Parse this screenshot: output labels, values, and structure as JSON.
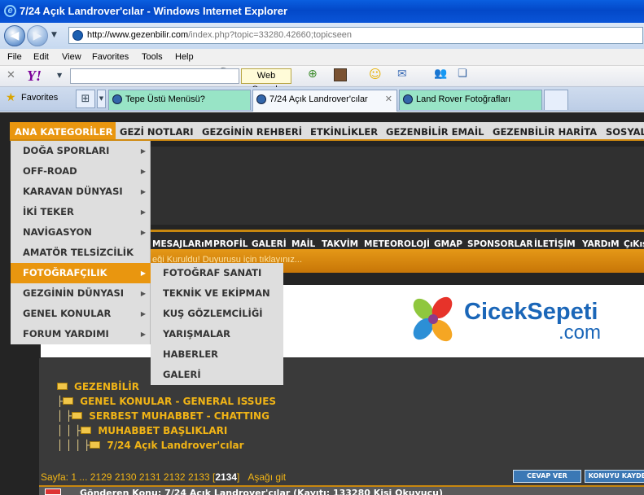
{
  "window": {
    "title": "7/24 Açık Landrover'cılar - Windows Internet Explorer"
  },
  "browser": {
    "back_label": "◀",
    "forward_label": "▶",
    "address_domain": "http://www.gezenbilir.com",
    "address_path": "/index.php?topic=33280.42660;topicseen",
    "menu": [
      "File",
      "Edit",
      "View",
      "Favorites",
      "Tools",
      "Help"
    ],
    "yahoo_logo": "Y!",
    "web_search_label": "Web Search",
    "favorites_label": "Favorites",
    "tabs": [
      {
        "label": "Tepe Üstü Menüsü?"
      },
      {
        "label": "7/24 Açık Landrover'cılar"
      },
      {
        "label": "Land Rover Fotoğrafları"
      }
    ]
  },
  "site": {
    "top_nav": [
      "ANA KATEGORİLER",
      "GEZİ NOTLARI",
      "GEZGİNİN REHBERİ",
      "ETKİNLİKLER",
      "GEZENBİLİR EMAİL",
      "GEZENBİLİR HARİTA",
      "SOSYAL"
    ],
    "sub_nav": [
      "MESAJLARıM",
      "PROFİL",
      "GALERİ",
      "MAİL",
      "TAKVİM",
      "METEOROLOJİ",
      "GMAP",
      "SPONSORLAR",
      "İLETİŞİM",
      "YARDıM",
      "ÇıKış"
    ],
    "ticker": "eği Kuruldu! Duyurusu için tıklayınız...",
    "dropdown": [
      "DOĞA SPORLARI",
      "OFF-ROAD",
      "KARAVAN DÜNYASI",
      "İKİ TEKER",
      "NAVİGASYON",
      "AMATÖR TELSİZCİLİK",
      "FOTOĞRAFÇILIK",
      "GEZGİNİN DÜNYASI",
      "GENEL KONULAR",
      "FORUM YARDIMI"
    ],
    "submenu": [
      "FOTOĞRAF SANATI",
      "TEKNİK VE EKİPMAN",
      "KUŞ GÖZLEMCİLİĞİ",
      "YARIŞMALAR",
      "HABERLER",
      "GALERİ"
    ],
    "ad": {
      "brand": "CicekSepeti",
      "domain": ".com"
    },
    "breadcrumb": [
      {
        "tree": "",
        "label": "GEZENBİLİR"
      },
      {
        "tree": "├",
        "label": "GENEL KONULAR - GENERAL ISSUES"
      },
      {
        "tree": "│ ├",
        "label": "SERBEST MUHABBET - CHATTING"
      },
      {
        "tree": "│ │ ├",
        "label": "MUHABBET BAŞLIKLARI"
      },
      {
        "tree": "│ │ │ ├",
        "label": "7/24 Açık Landrover'cılar"
      }
    ],
    "pagination": {
      "prefix": "Sayfa:",
      "first": "1",
      "ellipsis": "...",
      "pages": [
        "2129",
        "2130",
        "2131",
        "2132",
        "2133"
      ],
      "current": "2134",
      "go_down": "Aşağı git"
    },
    "buttons": {
      "reply": "CEVAP VER",
      "save_topic": "KONUYU KAYDE"
    },
    "footer_label": "Gönderen         Konu: 7/24 Açık Landrover'cılar  (Kayıtı: 133280 Kişi Okuyucu)"
  },
  "colors": {
    "accent_orange": "#e9960f",
    "site_bg": "#242424",
    "link_gold": "#f1b416"
  }
}
